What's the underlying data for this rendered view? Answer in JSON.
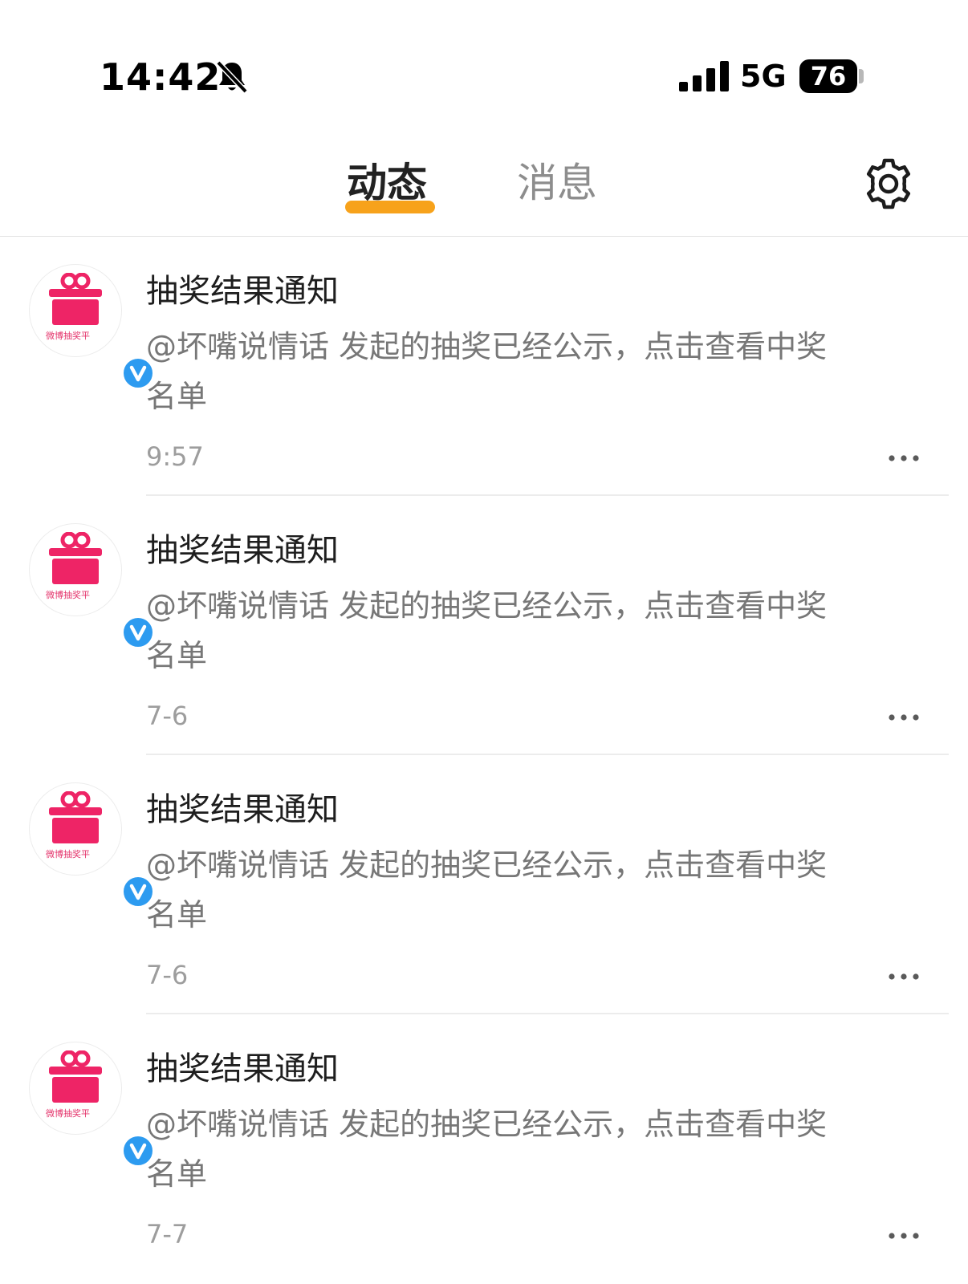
{
  "status_bar": {
    "time": "14:42",
    "network": "5G",
    "battery": "76"
  },
  "header": {
    "tabs": [
      {
        "label": "动态",
        "active": true
      },
      {
        "label": "消息",
        "active": false
      }
    ],
    "settings_icon": "gear-icon",
    "accent_color": "#f7a21b"
  },
  "feed": {
    "items": [
      {
        "avatar_text": "微博抽奖平",
        "title": "抽奖结果通知",
        "body": "@坏嘴说情话 发起的抽奖已经公示，点击查看中奖名单",
        "time": "9:57"
      },
      {
        "avatar_text": "微博抽奖平",
        "title": "抽奖结果通知",
        "body": "@坏嘴说情话 发起的抽奖已经公示，点击查看中奖名单",
        "time": "7-6"
      },
      {
        "avatar_text": "微博抽奖平",
        "title": "抽奖结果通知",
        "body": "@坏嘴说情话 发起的抽奖已经公示，点击查看中奖名单",
        "time": "7-6"
      },
      {
        "avatar_text": "微博抽奖平",
        "title": "抽奖结果通知",
        "body": "@坏嘴说情话 发起的抽奖已经公示，点击查看中奖名单",
        "time": "7-7"
      }
    ]
  },
  "colors": {
    "gift_pink": "#ee2466",
    "verified_blue": "#2d9bf0"
  }
}
